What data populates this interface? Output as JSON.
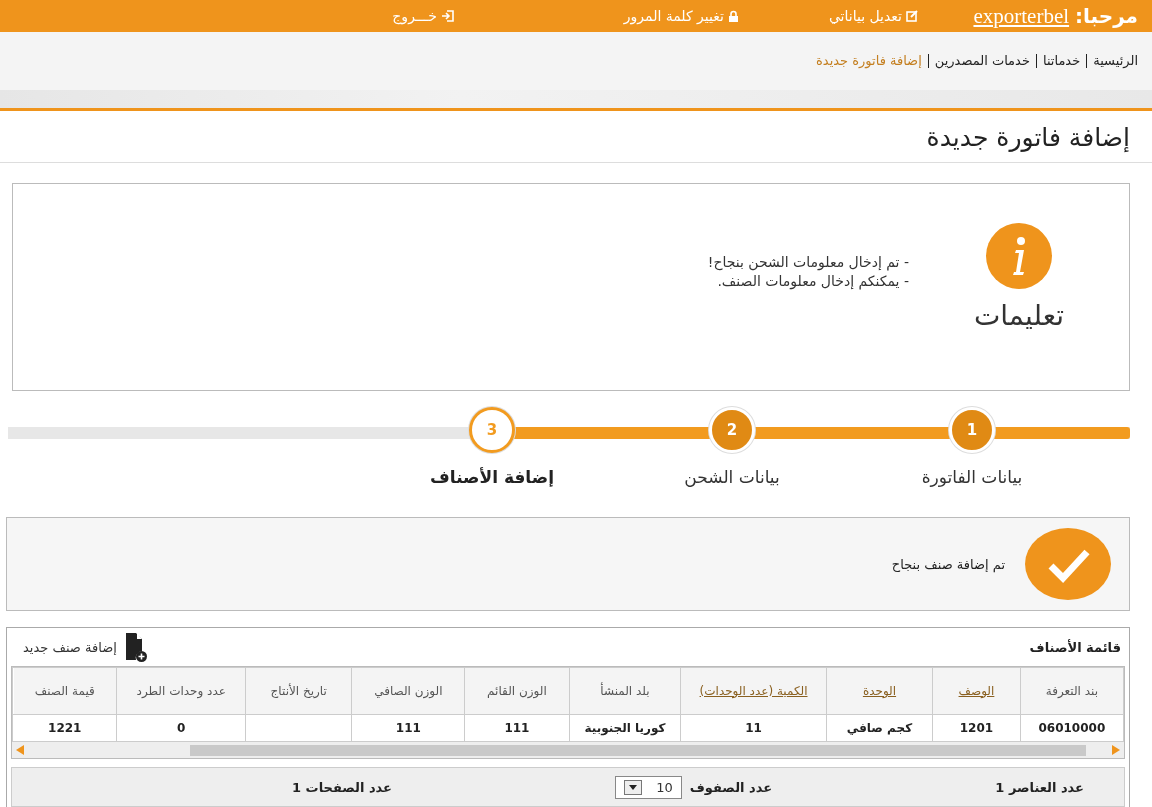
{
  "top_bar": {
    "greeting": "مرحبا:",
    "username": "exporterbel",
    "links": [
      {
        "kind": "edit",
        "label": "تعديل بياناتي"
      },
      {
        "kind": "lock",
        "label": "تغيير كلمة المرور"
      },
      {
        "kind": "logout",
        "label": "خـــروج"
      }
    ]
  },
  "breadcrumb": [
    {
      "label": "الرئيسية",
      "current": false
    },
    {
      "label": "خدماتنا",
      "current": false
    },
    {
      "label": "خدمات المصدرين",
      "current": false
    },
    {
      "label": "إضافة فاتورة جديدة",
      "current": true
    }
  ],
  "page_title": "إضافة فاتورة جديدة",
  "instructions": {
    "title": "تعليمات",
    "lines": [
      "- تم إدخال معلومات الشحن بنجاح!",
      "- يمكنكم إدخال معلومات الصنف."
    ]
  },
  "steps": [
    {
      "number": "1",
      "label": "بيانات الفاتورة",
      "selected": false
    },
    {
      "number": "2",
      "label": "بيانات الشحن",
      "selected": false
    },
    {
      "number": "3",
      "label": "إضافة الأصناف",
      "selected": true
    }
  ],
  "success_message": "تم إضافة صنف بنجاح",
  "items_panel": {
    "title": "قائمة الأصناف",
    "add_button": "إضافة صنف جديد",
    "columns": [
      {
        "label": "بند التعرفة",
        "sortable": false
      },
      {
        "label": "الوصف",
        "sortable": true
      },
      {
        "label": "الوحدة",
        "sortable": true
      },
      {
        "label": "الكمية (عدد الوحدات)",
        "sortable": true
      },
      {
        "label": "بلد المنشأ",
        "sortable": false
      },
      {
        "label": "الوزن القائم",
        "sortable": false
      },
      {
        "label": "الوزن الصافي",
        "sortable": false
      },
      {
        "label": "تاريخ الأنتاج",
        "sortable": false
      },
      {
        "label": "عدد وحدات الطرد",
        "sortable": false
      },
      {
        "label": "قيمة الصنف",
        "sortable": false
      }
    ],
    "rows": [
      [
        "06010000",
        "1201",
        "كجم صافي",
        "11",
        "كوريا الجنوبية",
        "111",
        "111",
        "",
        "0",
        "1221"
      ]
    ],
    "footer": {
      "items_count": "عدد العناصر 1",
      "rows_label": "عدد الصفوف",
      "rows_value": "10",
      "pages_count": "عدد الصفحات 1"
    }
  }
}
